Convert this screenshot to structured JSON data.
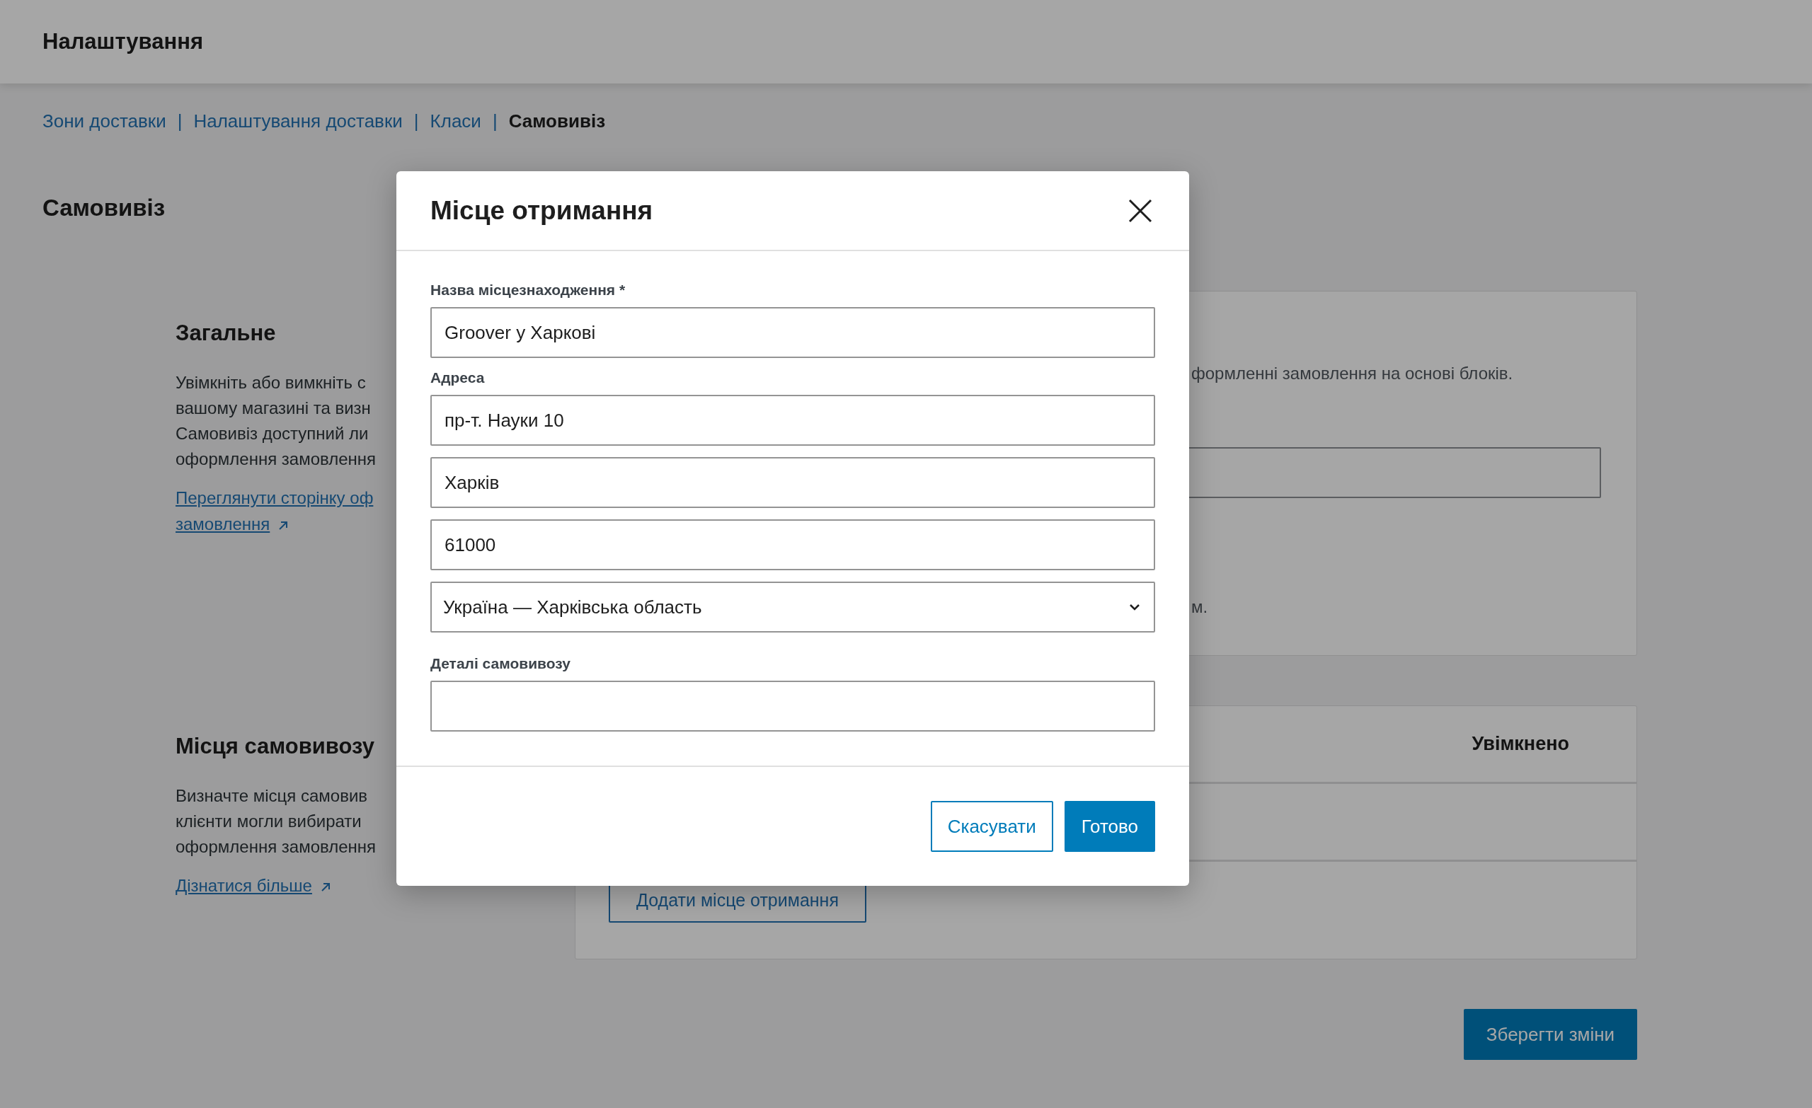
{
  "header": {
    "title": "Налаштування"
  },
  "breadcrumbs": [
    {
      "label": "Зони доставки",
      "selected": false
    },
    {
      "label": "Налаштування доставки",
      "separator": "|",
      "selected": false
    },
    {
      "label": "Класи",
      "separator": "|",
      "selected": false
    },
    {
      "label": "Самовивіз",
      "separator": "|",
      "selected": true
    }
  ],
  "page_title": "Самовивіз",
  "general": {
    "title": "Загальне",
    "description": "Увімкніть або вимкніть с\nвашому магазині та визн\nСамовивіз доступний ли\nоформлення замовлення",
    "link": "Переглянути сторінку оф\nзамовлення"
  },
  "general_card": {
    "text_1": "формленні замовлення на основі блоків.",
    "text_2": "м."
  },
  "locations": {
    "title": "Місця самовивозу",
    "description": "Визначте місця самовив\nклієнти могли вибирати\nоформлення замовлення",
    "link": "Дізнатися більше"
  },
  "locations_table": {
    "column_enabled": "Увімкнено",
    "add_button": "Додати місце отримання"
  },
  "save_button": "Зберегти зміни",
  "modal": {
    "title": "Місце отримання",
    "fields": [
      {
        "label": "Назва місцезнаходження *",
        "value": "Groover у Харкові",
        "kind": "text"
      },
      {
        "label": "Адреса",
        "value": "пр-т. Науки 10",
        "kind": "text"
      },
      {
        "value": "Харків",
        "kind": "text"
      },
      {
        "value": "61000",
        "kind": "text"
      },
      {
        "value": "Україна — Харківська область",
        "kind": "select"
      },
      {
        "label": "Деталі самовивозу",
        "kind": "text"
      }
    ],
    "buttons": [
      {
        "label": "Скасувати",
        "kind": "secondary"
      },
      {
        "label": "Готово",
        "kind": "primary"
      }
    ]
  }
}
